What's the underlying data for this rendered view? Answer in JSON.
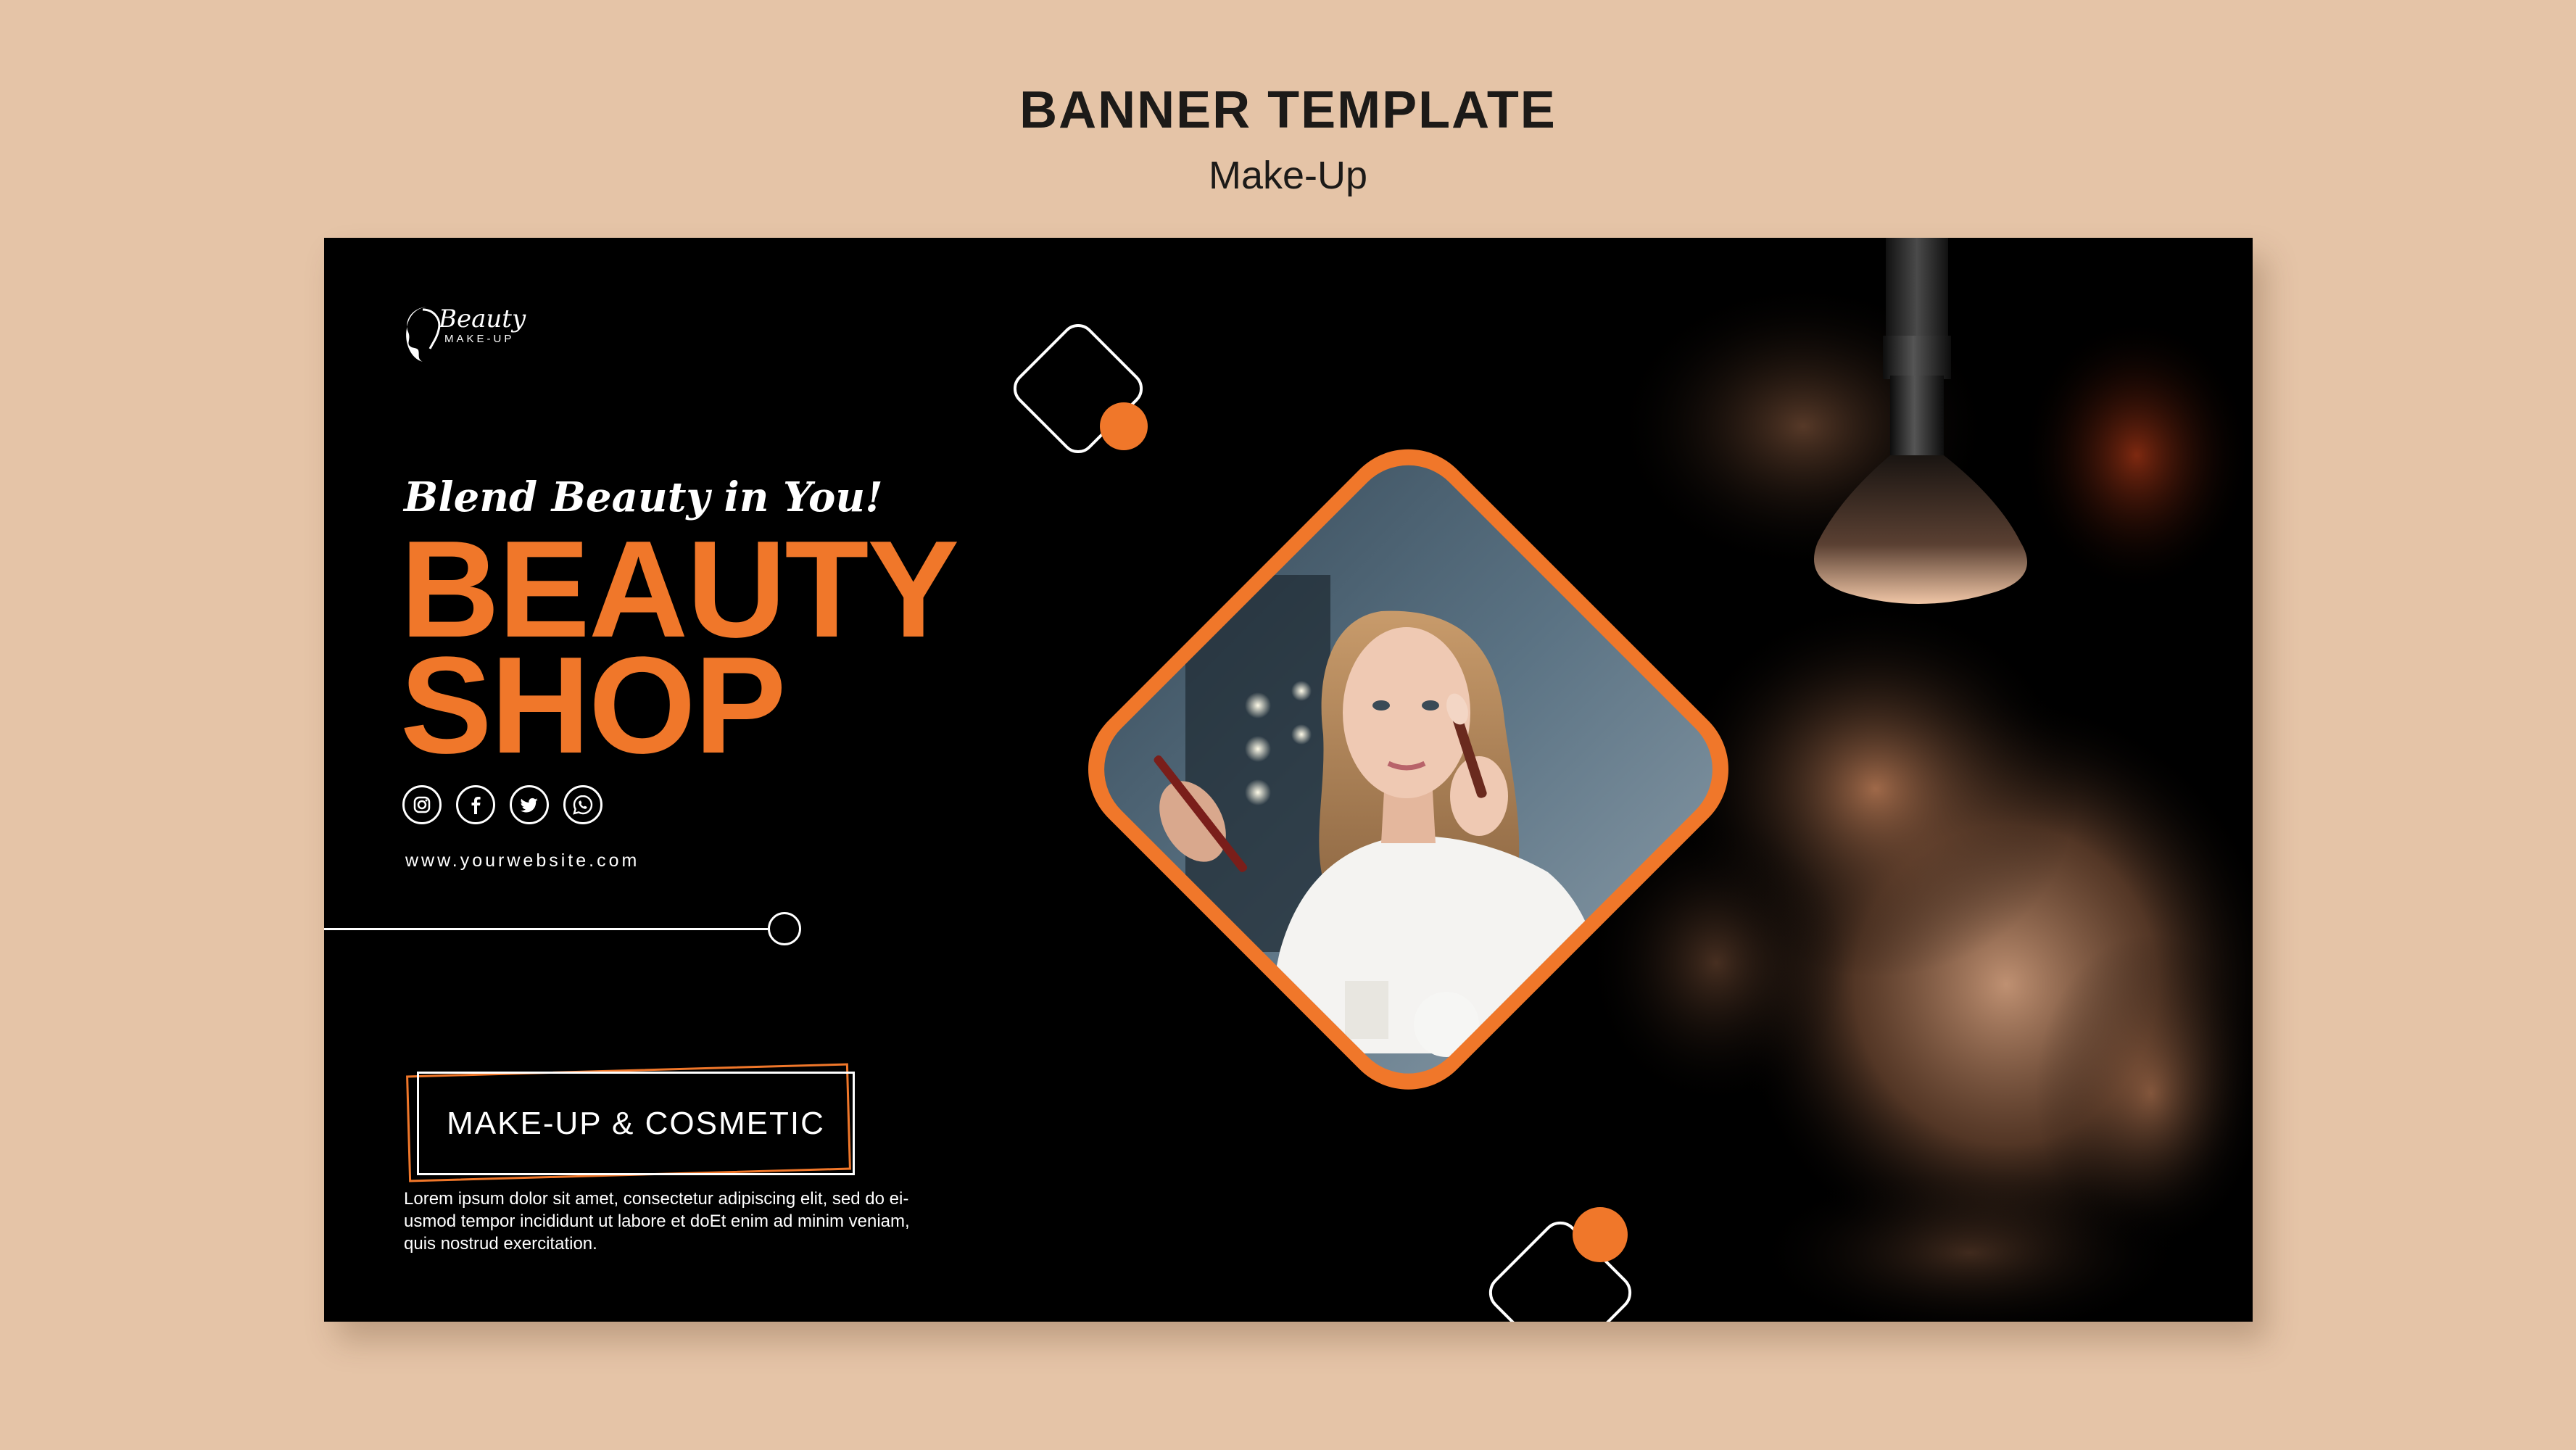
{
  "header": {
    "title": "BANNER TEMPLATE",
    "subtitle": "Make-Up"
  },
  "banner": {
    "logo": {
      "word": "Beauty",
      "sub": "MAKE-UP"
    },
    "tagline": "Blend Beauty in You!",
    "headline_line1": "BEAUTY",
    "headline_line2": "SHOP",
    "socials": [
      "instagram-icon",
      "facebook-icon",
      "twitter-icon",
      "whatsapp-icon"
    ],
    "website": "www.yourwebsite.com",
    "cta_label": "MAKE-UP & COSMETIC",
    "body_text": "Lorem ipsum dolor sit amet, consectetur adipiscing elit, sed do ei-usmod tempor incididunt ut labore et doEt enim ad minim veniam, quis nostrud exercitation."
  },
  "colors": {
    "page_background": "#e5c4a7",
    "banner_background": "#000000",
    "accent": "#f0772a",
    "text_light": "#ffffff",
    "text_dark": "#1c1a18"
  }
}
